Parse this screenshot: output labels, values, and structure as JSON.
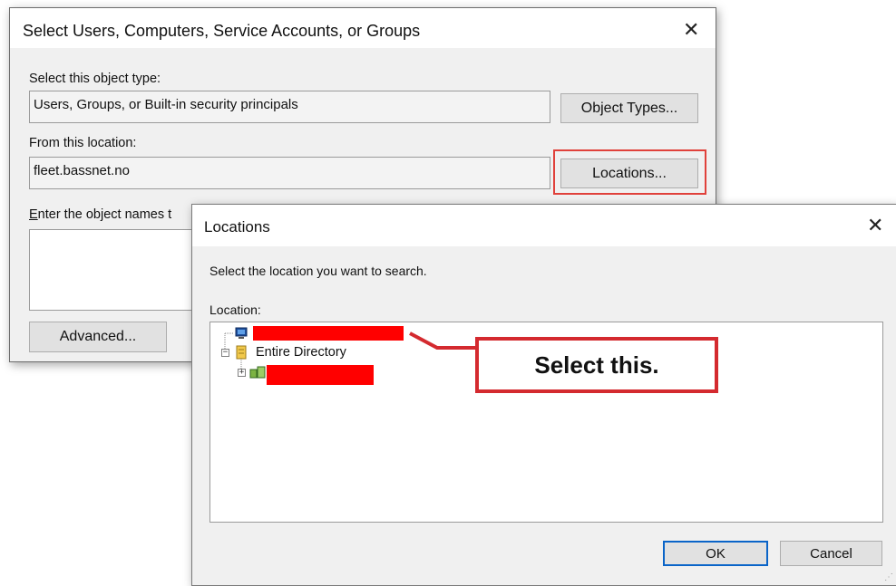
{
  "select_dialog": {
    "title": "Select Users, Computers, Service Accounts, or Groups",
    "object_type_label": "Select this object type:",
    "object_type_value": "Users, Groups, or Built-in security principals",
    "object_types_button": "Object Types...",
    "location_label": "From this location:",
    "location_value": "fleet.bassnet.no",
    "locations_button": "Locations...",
    "enter_names_label": "Enter the object names t",
    "advanced_button": "Advanced..."
  },
  "locations_dialog": {
    "title": "Locations",
    "instruction": "Select the location you want to search.",
    "location_label": "Location:",
    "tree": [
      {
        "label": "",
        "redacted": true,
        "icon": "computer-icon"
      },
      {
        "label": "Entire Directory",
        "icon": "directory-icon"
      },
      {
        "label": "",
        "redacted": true,
        "icon": "domain-icon"
      }
    ],
    "ok_button": "OK",
    "cancel_button": "Cancel"
  },
  "callout": {
    "text": "Select this."
  },
  "colors": {
    "highlight": "#e0413b",
    "redaction": "#ff0000",
    "callout_border": "#d42a2f"
  }
}
